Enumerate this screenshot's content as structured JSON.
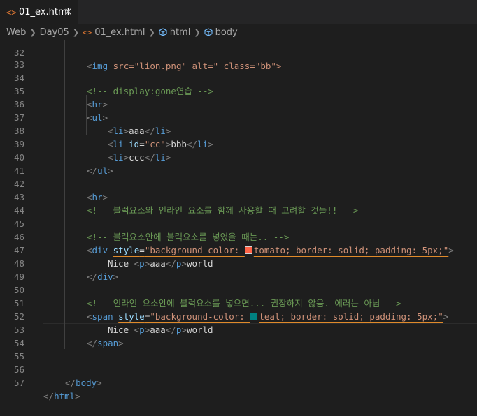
{
  "tab": {
    "icon": "<>",
    "filename": "01_ex.html",
    "close": "✕"
  },
  "breadcrumb": {
    "items": [
      "Web",
      "Day05",
      "01_ex.html",
      "html",
      "body"
    ],
    "file_icon": "<>"
  },
  "colors": {
    "tomato": "#ff6347",
    "teal": "#008080",
    "warning_underline": "#e08a2a"
  },
  "editor": {
    "line_numbers": [
      "32",
      "33",
      "34",
      "35",
      "36",
      "37",
      "38",
      "39",
      "40",
      "41",
      "42",
      "43",
      "44",
      "45",
      "46",
      "47",
      "48",
      "49",
      "50",
      "51",
      "52",
      "53",
      "54",
      "55",
      "56",
      "57"
    ],
    "line32": {
      "tag": "img",
      "attrs": "src=\"lion.png\" alt=\" class=\"bb\">"
    },
    "line34": {
      "comment": "<!-- display:gone연습 -->"
    },
    "line35": {
      "tag": "hr"
    },
    "line36": {
      "tag": "ul"
    },
    "line37": {
      "tag": "li",
      "text": "aaa"
    },
    "line38": {
      "tag": "li",
      "attr": "id",
      "value": "\"cc\"",
      "text": "bbb"
    },
    "line39": {
      "tag": "li",
      "text": "ccc"
    },
    "line40": {
      "tag": "ul"
    },
    "line42": {
      "tag": "hr"
    },
    "line43": {
      "comment": "<!-- 블럭요소와 인라인 요소를 함께 사용할 때 고려할 것들!! -->"
    },
    "line45": {
      "comment": "<!-- 블럭요소안에 블럭요소를 넣었을 때는.. -->"
    },
    "line46": {
      "tag": "div",
      "attr": "style",
      "value_before": "\"background-color: ",
      "value_after": "tomato; border: solid; padding: 5px;\""
    },
    "line47": {
      "text_before": "Nice ",
      "tag": "p",
      "inner": "aaa",
      "text_after": "world"
    },
    "line48": {
      "tag": "div"
    },
    "line50": {
      "comment": "<!-- 인라인 요소안에 블럭요소를 넣으면... 권장하지 않음. 에러는 아님 -->"
    },
    "line51": {
      "tag": "span",
      "attr": "style",
      "value_before": "\"background-color: ",
      "value_after": "teal; border: solid; padding: 5px;\""
    },
    "line52": {
      "text_before": "Nice ",
      "tag": "p",
      "inner": "aaa",
      "text_after": "world"
    },
    "line53": {
      "tag": "span"
    },
    "line56": {
      "tag": "body"
    },
    "line57": {
      "tag": "html"
    }
  }
}
